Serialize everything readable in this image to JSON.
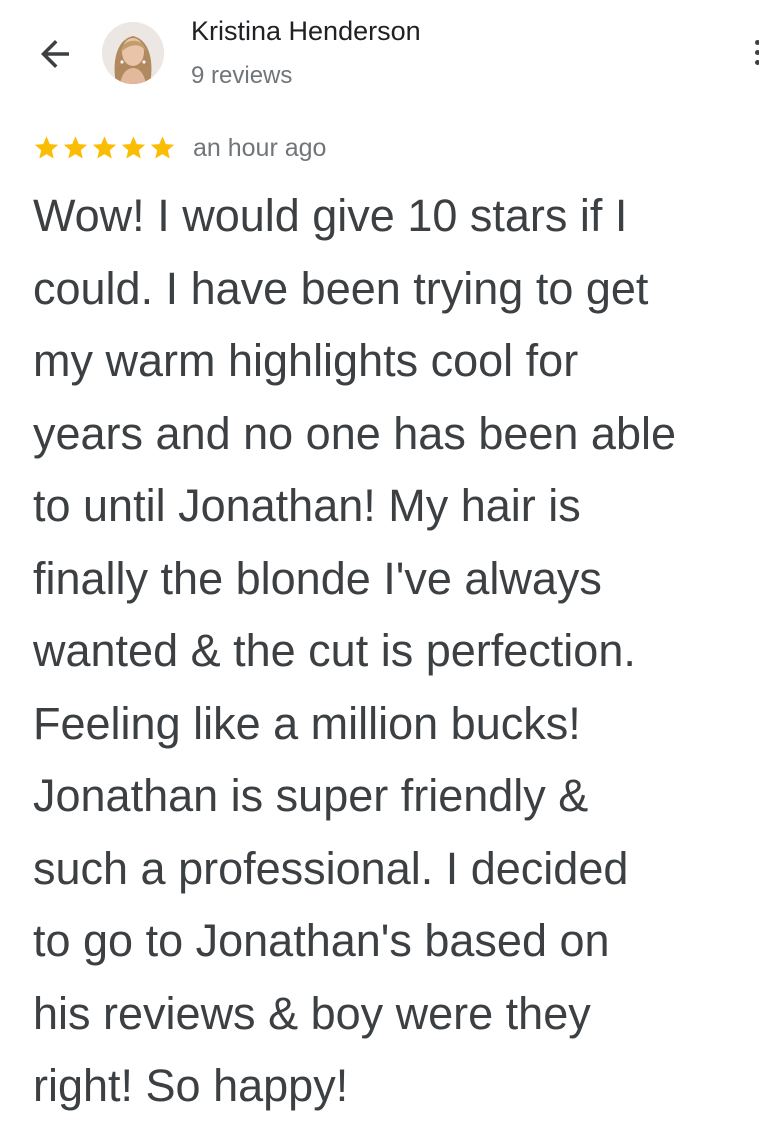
{
  "header": {
    "back_icon": "arrow-back-icon",
    "reviewer_name": "Kristina Henderson",
    "review_count": "9 reviews",
    "more_icon": "more-vert-icon"
  },
  "review": {
    "rating": 5,
    "rating_max": 5,
    "star_color": "#fbbc04",
    "time_ago": "an hour ago",
    "lines": [
      "Wow! I would give 10 stars if I",
      "could. I have been trying to get",
      "my warm highlights cool for",
      "years and no one has been able",
      "to until Jonathan! My hair is",
      "finally the blonde I've always",
      "wanted & the cut is perfection.",
      "Feeling like a million bucks!",
      "Jonathan is super friendly &",
      "such a professional. I decided",
      "to go to Jonathan's based on",
      "his reviews & boy were they",
      "right! So happy!"
    ]
  }
}
